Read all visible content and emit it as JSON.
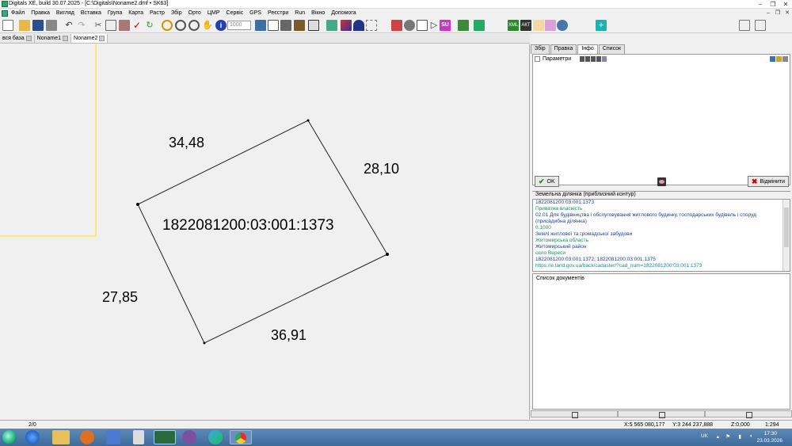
{
  "window": {
    "title": "Digitals XE, build 30.07.2025 - [C:\\Digitals\\Noname2.dmf • SK63]"
  },
  "menu": [
    "Файл",
    "Правка",
    "Вигляд",
    "Вставка",
    "Група",
    "Карта",
    "Растр",
    "Збір",
    "Орто",
    "ЦМР",
    "Сервіс",
    "GPS",
    "Реєстри",
    "Run",
    "Вікно",
    "Допомога"
  ],
  "toolbar": {
    "scale_placeholder": "1000",
    "xml_label": "XML",
    "su_label": "SU",
    "akt_label": "АКТ"
  },
  "doc_tabs": [
    "вся база",
    "Noname1",
    "Noname2"
  ],
  "canvas": {
    "parcel_id": "1822081200:03:001:1373",
    "edge_labels": [
      "34,48",
      "28,10",
      "36,91",
      "27,85"
    ]
  },
  "right_panel": {
    "tabs": [
      "Збір",
      "Правка",
      "Інфо",
      "Список"
    ],
    "active_tab": "Інфо",
    "params_label": "Параметри",
    "ok_label": "OK",
    "cancel_label": "Відмінити",
    "info_title": "Земельна ділянка (приблизний контур)",
    "info_lines": [
      {
        "text": "1822081200:03:001:1373",
        "color": "blue"
      },
      {
        "text": "Приватна власність",
        "color": "green"
      },
      {
        "text": "02.01 Для будівництва і обслуговування житлового будинку, господарських будівель і споруд (присадибна ділянка)",
        "color": "blue",
        "wrap": true
      },
      {
        "text": "0.1000",
        "color": "green"
      },
      {
        "text": "Землі житлової та громадської забудови",
        "color": "blue"
      },
      {
        "text": "Житомирська область",
        "color": "green"
      },
      {
        "text": "Житомирський район",
        "color": "blue"
      },
      {
        "text": "село Вереси",
        "color": "green"
      },
      {
        "text": "1822081200:03:001:1372, 1822081200:03:001:1375",
        "color": "blue"
      },
      {
        "text": "https://e.land.gov.ua/back/cadaster/?cad_num=1822081200:03:001:1373",
        "color": "link"
      }
    ],
    "docs_title": "Список документів"
  },
  "status": {
    "counter": "2/0",
    "x": "X:5 565 080,177",
    "y": "Y:3 244 237,888",
    "z": "Z:0,000",
    "scale": "1:294"
  },
  "taskbar": {
    "lang": "UK",
    "time": "17:30",
    "date": "23.03.2026"
  }
}
